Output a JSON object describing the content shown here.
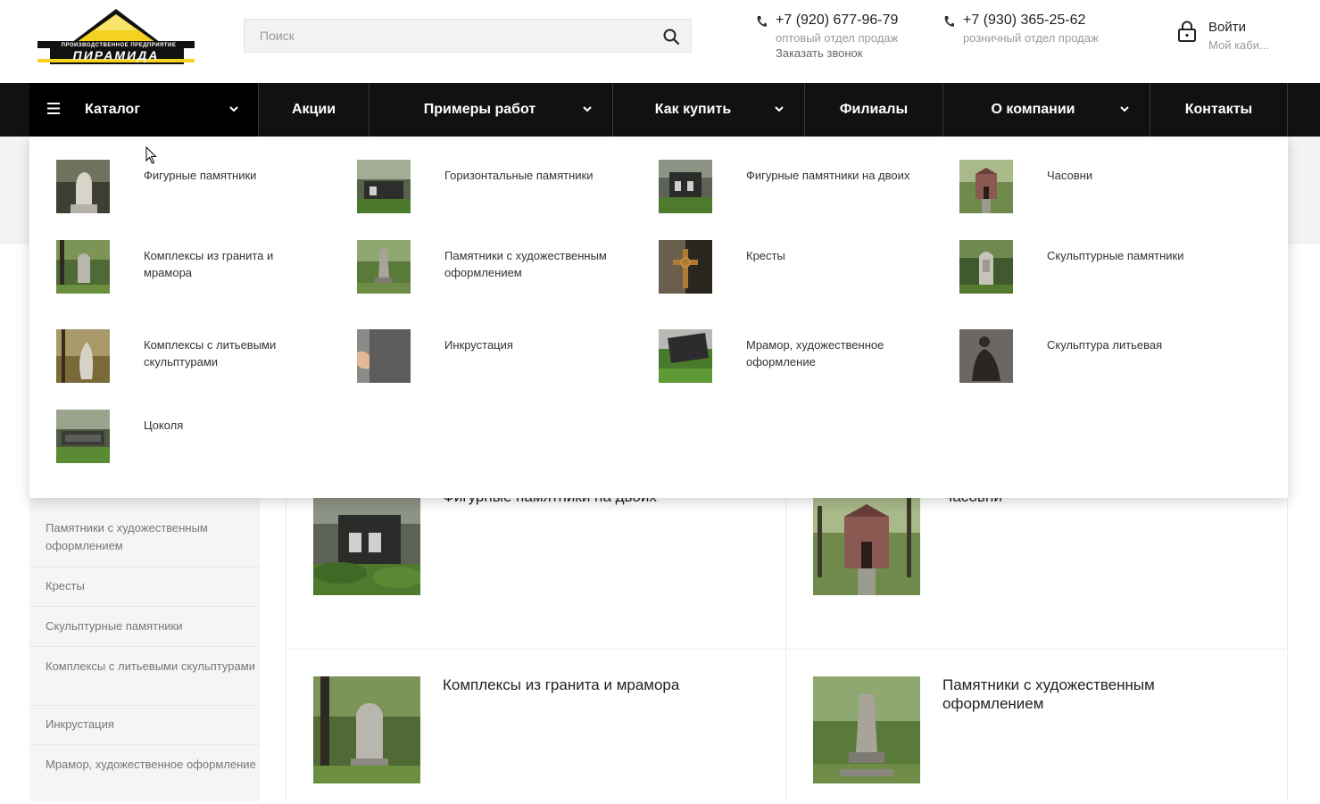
{
  "header": {
    "logo": {
      "top_text": "ПРОИЗВОДСТВЕННОЕ ПРЕДПРИЯТИЕ",
      "name": "ПИРАМИДА"
    },
    "search": {
      "placeholder": "Поиск",
      "value": ""
    },
    "phones": [
      {
        "number": "+7 (920) 677-96-79",
        "desc": "оптовый отдел продаж",
        "callback": "Заказать звонок"
      },
      {
        "number": "+7 (930) 365-25-62",
        "desc": "розничный отдел продаж"
      }
    ],
    "login": {
      "label": "Войти",
      "sub": "Мой каби..."
    }
  },
  "nav": {
    "items": [
      {
        "label": "Каталог"
      },
      {
        "label": "Акции"
      },
      {
        "label": "Примеры работ"
      },
      {
        "label": "Как купить"
      },
      {
        "label": "Филиалы"
      },
      {
        "label": "О компании"
      },
      {
        "label": "Контакты"
      }
    ]
  },
  "mega_menu": {
    "items": [
      {
        "label": "Фигурные памятники"
      },
      {
        "label": "Горизонтальные памятники"
      },
      {
        "label": "Фигурные памятники на двоих"
      },
      {
        "label": "Часовни"
      },
      {
        "label": "Комплексы из гранита и мрамора"
      },
      {
        "label": "Памятники с художественным оформлением"
      },
      {
        "label": "Кресты"
      },
      {
        "label": "Скульптурные памятники"
      },
      {
        "label": "Комплексы с литьевыми скульптурами"
      },
      {
        "label": "Инкрустация"
      },
      {
        "label": "Мрамор, художественное оформление"
      },
      {
        "label": "Скульптура литьевая"
      },
      {
        "label": "Цоколя"
      }
    ]
  },
  "sidebar": {
    "items": [
      {
        "label": "Памятники с художественным оформлением"
      },
      {
        "label": "Кресты"
      },
      {
        "label": "Скульптурные памятники"
      },
      {
        "label": "Комплексы с литьевыми скульптурами"
      },
      {
        "label": "Инкрустация"
      },
      {
        "label": "Мрамор, художественное оформление"
      }
    ]
  },
  "grid": {
    "cards": [
      {
        "title": "Фигурные памятники на двоих"
      },
      {
        "title": "Часовни"
      },
      {
        "title": "Комплексы из гранита и мрамора"
      },
      {
        "title": "Памятники с художественным оформлением"
      }
    ]
  },
  "colors": {
    "nav_bg": "#111111",
    "logo_yellow": "#f4d21f",
    "text": "#222222",
    "muted": "#9a9a9a"
  }
}
